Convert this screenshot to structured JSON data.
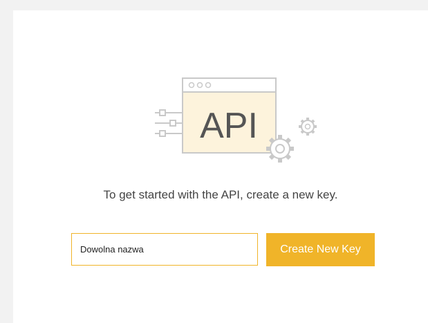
{
  "hero": {
    "illustration_icon": "api-window-gears-icon",
    "api_label": "API",
    "colors": {
      "frame": "#c9c9c9",
      "panel": "#fdf3dc",
      "text": "#555555",
      "accent": "#f0b429"
    }
  },
  "intro": {
    "text": "To get started with the API, create a new key."
  },
  "key_form": {
    "name_value": "Dowolna nazwa",
    "create_label": "Create New Key"
  }
}
